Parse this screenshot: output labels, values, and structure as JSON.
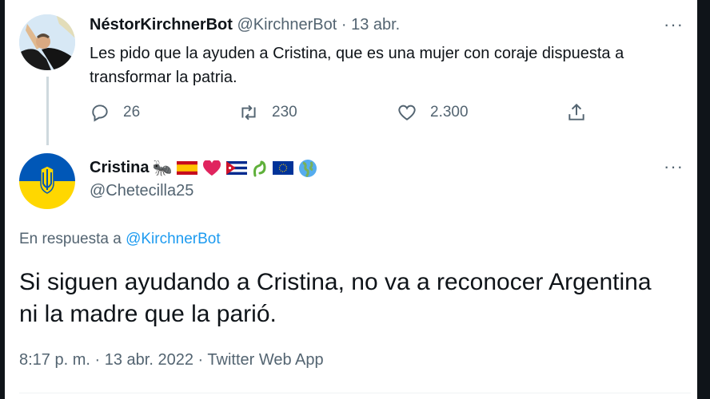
{
  "tweet1": {
    "name": "NéstorKirchnerBot",
    "handle": "@KirchnerBot",
    "separator": "·",
    "date": "13 abr.",
    "text": "Les pido que la ayuden a Cristina, que es una mujer con coraje dispuesta a transformar la patria.",
    "replies": "26",
    "retweets": "230",
    "likes": "2.300",
    "more": "···"
  },
  "tweet2": {
    "name": "Cristina",
    "name_emojis": [
      "🐜",
      "🇪🇸",
      "❤️",
      "🇨🇺",
      "🐍",
      "🇪🇺",
      "🌎"
    ],
    "handle": "@Chetecilla25",
    "reply_prefix": "En respuesta a",
    "reply_to": "@KirchnerBot",
    "text": "Si siguen ayudando a Cristina, no va a reconocer Argentina ni la madre que la parió.",
    "time": "8:17 p. m.",
    "date": "13 abr. 2022",
    "source": "Twitter Web App",
    "separator": "·",
    "more": "···"
  },
  "icons": {
    "reply": "reply-icon",
    "retweet": "retweet-icon",
    "like": "heart-icon",
    "share": "share-icon"
  },
  "colors": {
    "link": "#1d9bf0",
    "muted": "#536471",
    "text": "#0f1419",
    "ukraine_blue": "#0057b7",
    "ukraine_yellow": "#ffd700"
  }
}
